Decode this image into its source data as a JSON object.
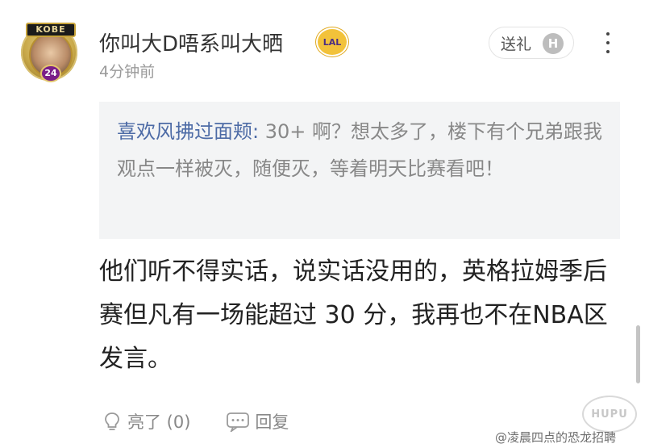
{
  "user": {
    "name": "你叫大D唔系叫大晒",
    "team_badge": "LAL",
    "time": "4分钟前",
    "avatar": {
      "label": "KOBE",
      "number": "24"
    }
  },
  "gift_button": {
    "label": "送礼",
    "icon_letter": "H"
  },
  "quote": {
    "user": "喜欢风拂过面颊:",
    "text": " 30+ 啊？想太多了，楼下有个兄弟跟我观点一样被灭，随便灭，等着明天比赛看吧！"
  },
  "comment": {
    "text": "他们听不得实话，说实话没用的，英格拉姆季后赛但凡有一场能超过 30 分，我再也不在NBA区发言。"
  },
  "actions": {
    "like_label": "亮了 (0)",
    "reply_label": "回复"
  },
  "watermark": {
    "logo_text": "HUPU",
    "text": "@凌晨四点的恐龙招聘"
  },
  "colors": {
    "quote_user": "#4d6ba6",
    "badge_bg": "#f2c23a",
    "badge_text": "#4b2e83"
  }
}
